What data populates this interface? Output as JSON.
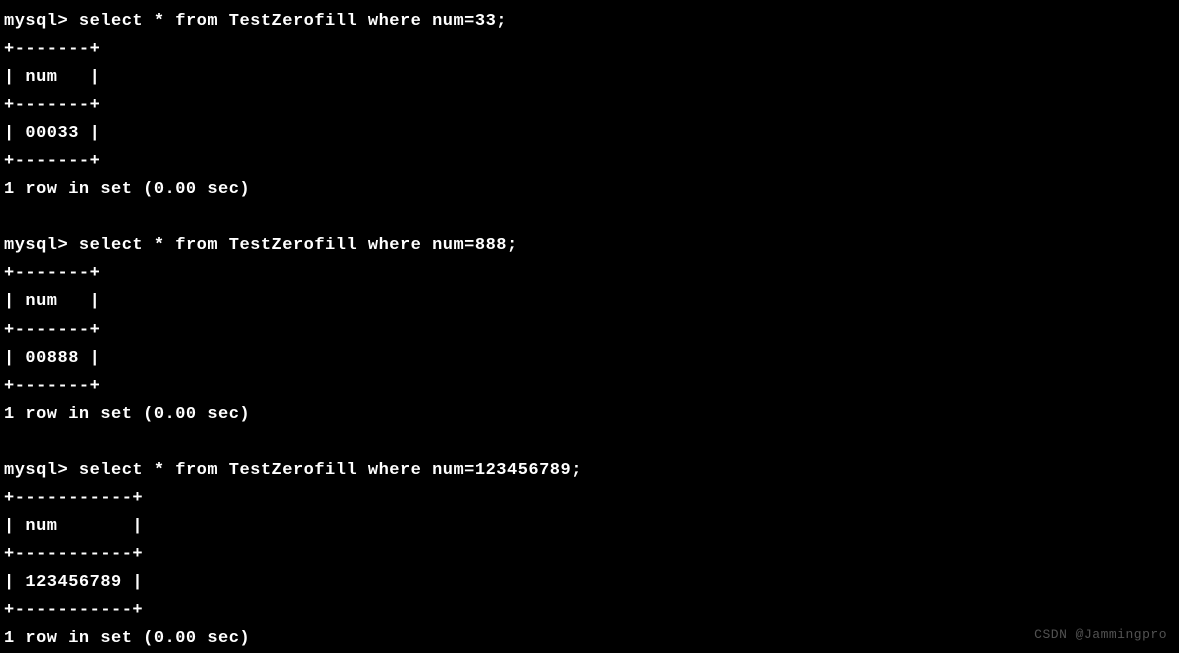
{
  "queries": [
    {
      "prompt": "mysql> ",
      "command": "select * from TestZerofill where num=33;",
      "border": "+-------+",
      "header": "| num   |",
      "row": "| 00033 |",
      "status": "1 row in set (0.00 sec)"
    },
    {
      "prompt": "mysql> ",
      "command": "select * from TestZerofill where num=888;",
      "border": "+-------+",
      "header": "| num   |",
      "row": "| 00888 |",
      "status": "1 row in set (0.00 sec)"
    },
    {
      "prompt": "mysql> ",
      "command": "select * from TestZerofill where num=123456789;",
      "border": "+-----------+",
      "header": "| num       |",
      "row": "| 123456789 |",
      "status": "1 row in set (0.00 sec)"
    }
  ],
  "watermark": "CSDN @Jammingpro",
  "watermark2": ""
}
